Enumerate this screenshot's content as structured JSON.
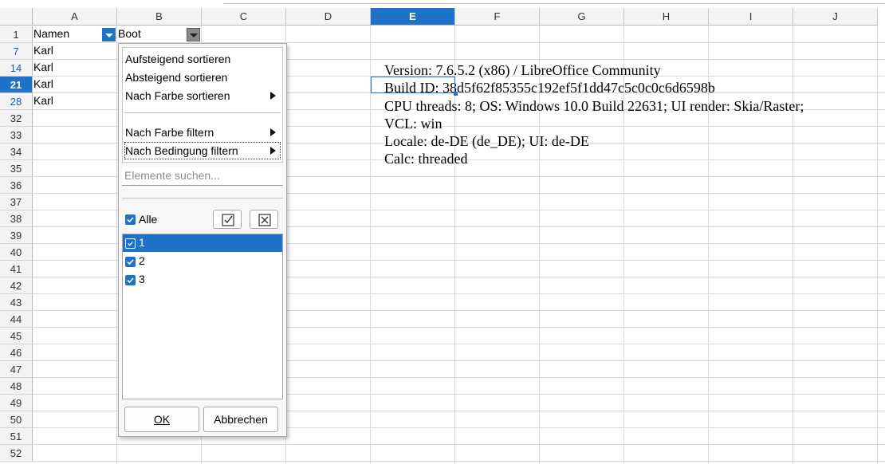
{
  "columns": [
    "A",
    "B",
    "C",
    "D",
    "E",
    "F",
    "G",
    "H",
    "I",
    "J"
  ],
  "active_column": "E",
  "rows": [
    {
      "num": "1",
      "state": "normal"
    },
    {
      "num": "7",
      "state": "filtered"
    },
    {
      "num": "14",
      "state": "filtered"
    },
    {
      "num": "21",
      "state": "active"
    },
    {
      "num": "28",
      "state": "filtered"
    },
    {
      "num": "32"
    },
    {
      "num": "33"
    },
    {
      "num": "34"
    },
    {
      "num": "35"
    },
    {
      "num": "36"
    },
    {
      "num": "37"
    },
    {
      "num": "38"
    },
    {
      "num": "39"
    },
    {
      "num": "40"
    },
    {
      "num": "41"
    },
    {
      "num": "42"
    },
    {
      "num": "43"
    },
    {
      "num": "44"
    },
    {
      "num": "45"
    },
    {
      "num": "46"
    },
    {
      "num": "47"
    },
    {
      "num": "48"
    },
    {
      "num": "49"
    },
    {
      "num": "50"
    },
    {
      "num": "51"
    },
    {
      "num": "52"
    }
  ],
  "cells": {
    "header_a": "Namen",
    "header_b": "Boot",
    "a_values": [
      "Karl",
      "Karl",
      "Karl",
      "Karl"
    ]
  },
  "info_lines": [
    "Version: 7.6.5.2 (x86) / LibreOffice Community",
    "Build ID: 38d5f62f85355c192ef5f1dd47c5c0c0c6d6598b",
    "CPU threads: 8; OS: Windows 10.0 Build 22631; UI render: Skia/Raster;",
    "VCL: win",
    "Locale: de-DE (de_DE); UI: de-DE",
    "Calc: threaded"
  ],
  "autofilter_popup": {
    "sort_ascending": "Aufsteigend sortieren",
    "sort_descending": "Absteigend sortieren",
    "sort_by_color": "Nach Farbe sortieren",
    "filter_by_color": "Nach Farbe filtern",
    "filter_by_condition": "Nach Bedingung filtern",
    "search_placeholder": "Elemente suchen...",
    "all_label": "Alle",
    "items": [
      {
        "label": "1",
        "checked": true,
        "selected": true
      },
      {
        "label": "2",
        "checked": true,
        "selected": false
      },
      {
        "label": "3",
        "checked": true,
        "selected": false
      }
    ],
    "ok_label": "OK",
    "cancel_label": "Abbrechen"
  }
}
